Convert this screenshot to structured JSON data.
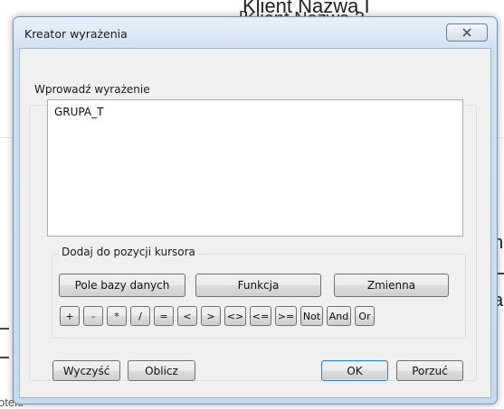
{
  "background": {
    "header_line1": "Klient  Nazwa I",
    "header_line2": "[Klient  Nazwa 2",
    "right_fragment_1": "n",
    "right_fragment_2": "a",
    "bottom_left_fragment": "oteki"
  },
  "dialog": {
    "title": "Kreator wyrażenia",
    "close_icon": "close-x-icon",
    "expression_label": "Wprowadź wyrażenie",
    "expression_value": "GRUPA_T",
    "insert_group_label": "Dodaj do pozycji kursora",
    "insert_buttons": {
      "db_field": "Pole bazy danych",
      "function": "Funkcja",
      "variable": "Zmienna"
    },
    "operators": [
      "+",
      "-",
      "*",
      "/",
      "=",
      "<",
      ">",
      "<>",
      "<=",
      ">=",
      "Not",
      "And",
      "Or"
    ],
    "footer": {
      "clear": "Wyczyść",
      "calculate": "Oblicz",
      "ok": "OK",
      "cancel": "Porzuć"
    }
  }
}
